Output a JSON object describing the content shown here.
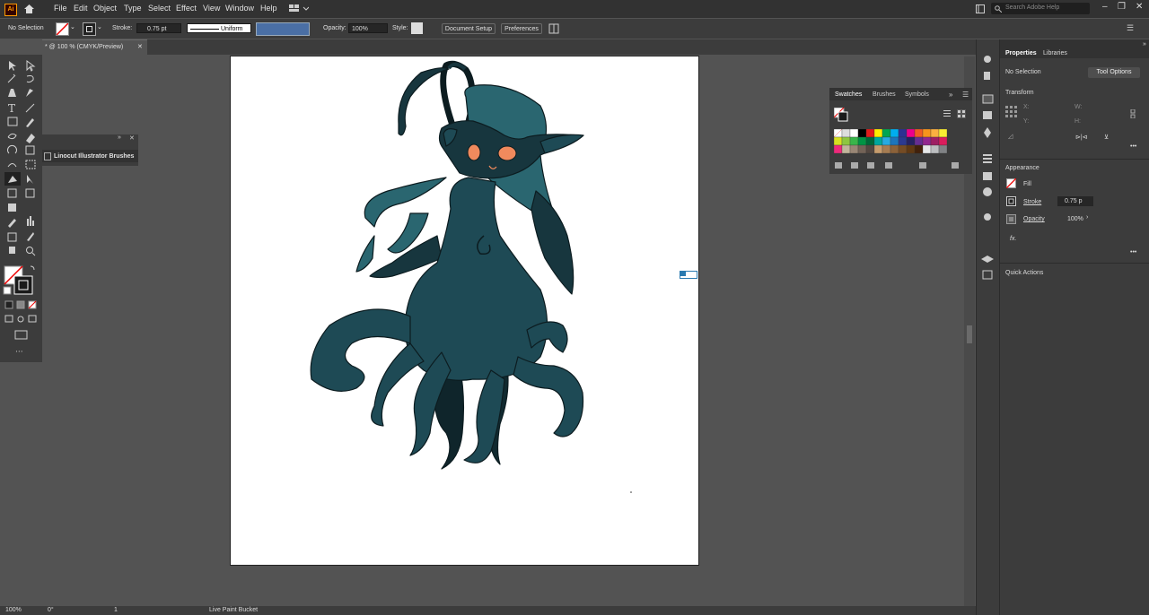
{
  "menu": {
    "items": [
      "File",
      "Edit",
      "Object",
      "Type",
      "Select",
      "Effect",
      "View",
      "Window",
      "Help"
    ],
    "search_placeholder": "Search Adobe Help"
  },
  "control": {
    "selection": "No Selection",
    "stroke_label": "Stroke:",
    "stroke_value": "0.75 pt",
    "profile": "Uniform",
    "opacity_label": "Opacity:",
    "opacity_value": "100%",
    "style_label": "Style:",
    "doc_setup": "Document Setup",
    "preferences": "Preferences"
  },
  "doc_tab": {
    "title": "* @ 100 % (CMYK/Preview)"
  },
  "brush_panel": {
    "title": "Linocut Illustrator Brushes"
  },
  "swatches": {
    "tabs": [
      "Swatches",
      "Brushes",
      "Symbols"
    ]
  },
  "properties": {
    "tabs": [
      "Properties",
      "Libraries"
    ],
    "selection": "No Selection",
    "tool_options": "Tool Options",
    "transform_title": "Transform",
    "x_label": "X:",
    "y_label": "Y:",
    "w_label": "W:",
    "h_label": "H:",
    "appearance_title": "Appearance",
    "fill_label": "Fill",
    "stroke_label": "Stroke",
    "stroke_value": "0.75 p",
    "opacity_label": "Opacity",
    "opacity_value": "100%",
    "fx_label": "fx.",
    "quick_actions": "Quick Actions"
  },
  "status": {
    "zoom": "100%",
    "rotation": "0°",
    "artboard": "1",
    "tool": "Live Paint Bucket"
  },
  "colors": {
    "teal_dark": "#17363e",
    "teal_mid": "#1e4a55",
    "teal_light": "#2a6670",
    "eye_orange": "#f08a5d"
  }
}
